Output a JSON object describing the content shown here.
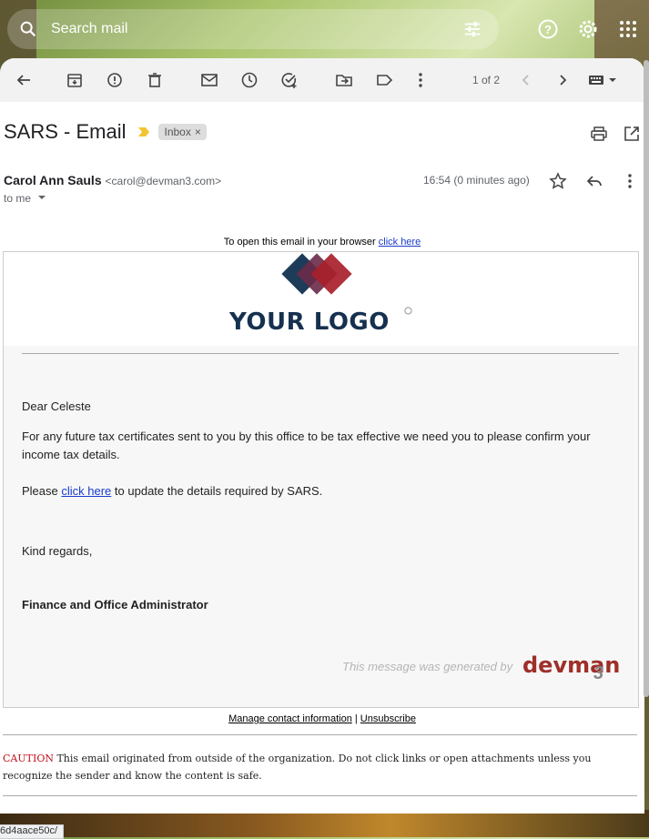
{
  "search": {
    "placeholder": "Search mail"
  },
  "toolbar": {
    "pager": "1 of 2"
  },
  "email": {
    "subject": "SARS - Email",
    "label": "Inbox",
    "label_close": "×",
    "sender_name": "Carol Ann Sauls",
    "sender_email": "<carol@devman3.com>",
    "to": "to me",
    "time": "16:54 (0 minutes ago)"
  },
  "message": {
    "browser_prefix": "To open this email in your browser",
    "browser_link": "click here",
    "logo_text": "YOUR LOGO",
    "greeting": "Dear Celeste",
    "para1": "For any future tax certificates sent to you by this office to be tax effective we need you to please confirm your income tax details.",
    "para2_prefix": "Please",
    "para2_link": "click here",
    "para2_suffix": "to update the details required by SARS.",
    "regards": "Kind regards,",
    "signature": "Finance and Office Administrator",
    "generated_by": "This message was generated by",
    "brand": "devman",
    "brand_suffix": "3"
  },
  "footer": {
    "manage": "Manage contact information",
    "divider": "|",
    "unsubscribe": "Unsubscribe",
    "caution_label": "CAUTION",
    "caution_text": "This email originated from outside of the organization. Do not click links or open attachments unless you recognize the sender and know the content is safe."
  },
  "statusbar": {
    "url": "6d4aace50c/"
  },
  "colors": {
    "accent": "#1a3ccc",
    "logo_navy": "#16314f",
    "brand_red": "#9e2f29",
    "caution_red": "#c0121e"
  }
}
